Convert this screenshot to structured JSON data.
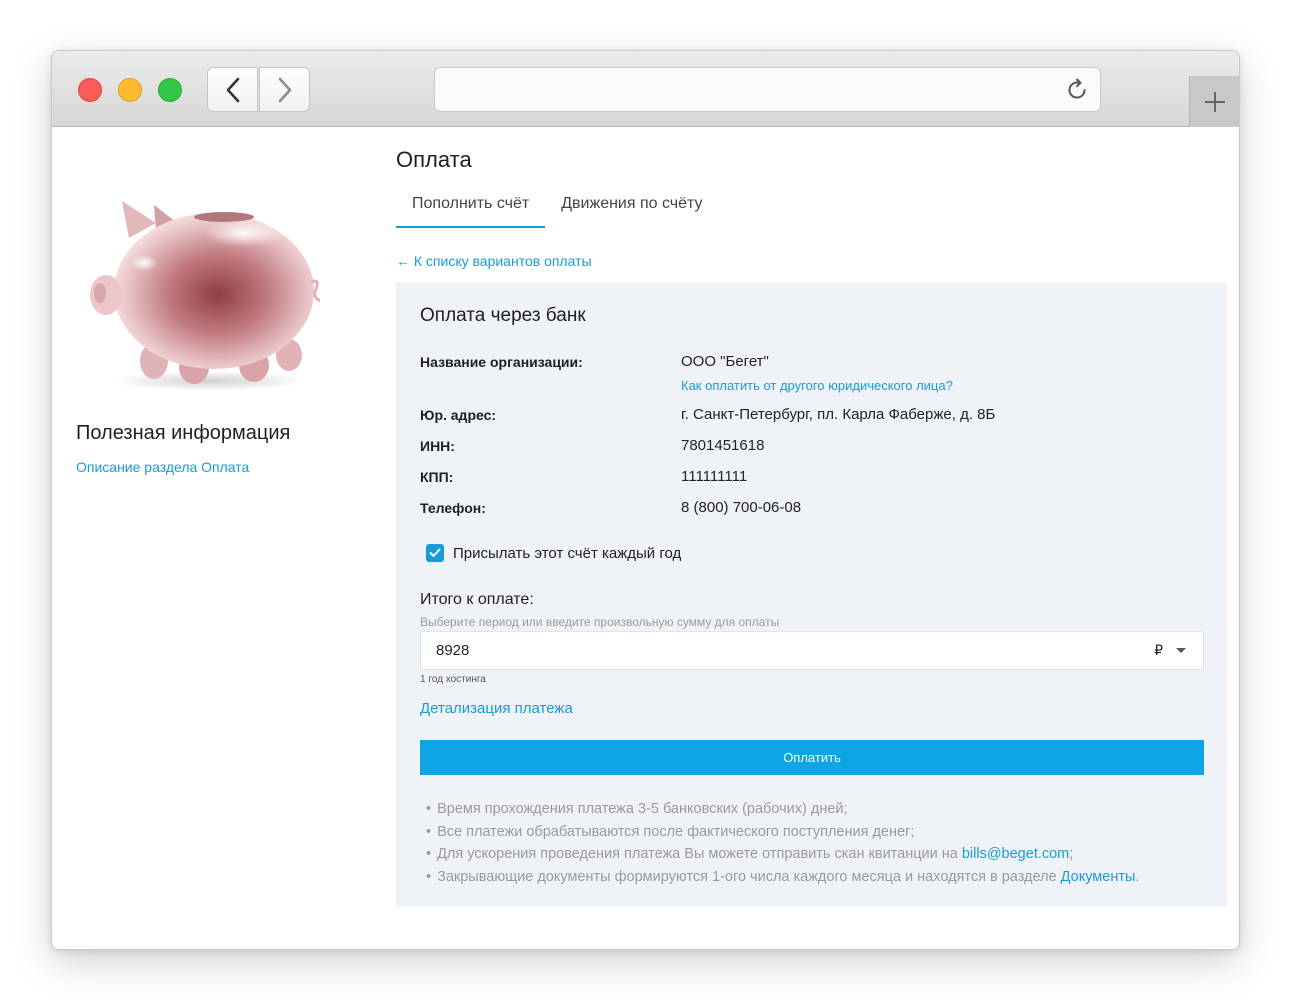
{
  "page": {
    "title": "Оплата",
    "tabs": [
      {
        "label": "Пополнить счёт",
        "active": true
      },
      {
        "label": "Движения по счёту",
        "active": false
      }
    ],
    "back_link": "← К списку вариантов оплаты"
  },
  "sidebar": {
    "useful_title": "Полезная информация",
    "useful_link": "Описание раздела Оплата"
  },
  "panel": {
    "title": "Оплата через банк",
    "org_label": "Название организации:",
    "org_value": "ООО \"Бегет\"",
    "org_link": "Как оплатить от другого юридического лица?",
    "address_label": "Юр. адрес:",
    "address_value": "г. Санкт-Петербург, пл. Карла Фаберже, д. 8Б",
    "inn_label": "ИНН:",
    "inn_value": "7801451618",
    "kpp_label": "КПП:",
    "kpp_value": "111111111",
    "phone_label": "Телефон:",
    "phone_value": "8 (800) 700-06-08",
    "checkbox_label": "Присылать этот счёт каждый год",
    "checkbox_checked": true,
    "total_title": "Итого к оплате:",
    "total_hint": "Выберите период или введите произвольную сумму для оплаты",
    "amount_value": "8928",
    "currency": "₽",
    "period_note": "1 год хостинга",
    "details_link": "Детализация платежа",
    "pay_button": "Оплатить",
    "notes": {
      "n1": "Время прохождения платежа 3-5 банковских (рабочих) дней;",
      "n2": "Все платежи обрабатываются после фактического поступления денег;",
      "n3_text": "Для ускорения проведения платежа Вы можете отправить скан квитанции на ",
      "n3_link": "bills@beget.com",
      "n3_end": ";",
      "n4_text": "Закрывающие документы формируются 1-ого числа каждого месяца и находятся в разделе ",
      "n4_link": "Документы",
      "n4_end": "."
    },
    "bullet": "•"
  },
  "colors": {
    "accent": "#1a9bd7",
    "button": "#0ea5e4",
    "panel_bg": "#eff3f7"
  },
  "icons": {
    "back": "chevron-left-icon",
    "forward": "chevron-right-icon",
    "reload": "reload-icon",
    "new_tab": "plus-icon",
    "checkbox": "check-icon",
    "dropdown": "caret-down-icon"
  }
}
